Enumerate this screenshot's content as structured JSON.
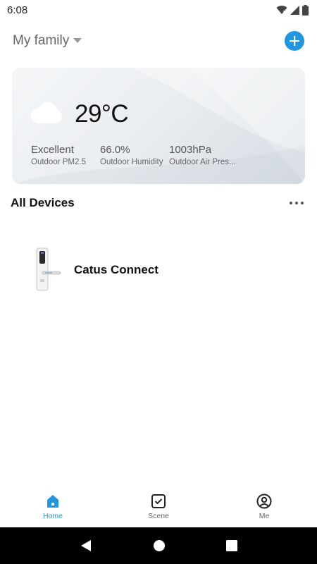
{
  "status_bar": {
    "time": "6:08",
    "icons": [
      "wifi-icon",
      "cell-signal-icon",
      "battery-icon"
    ]
  },
  "header": {
    "family_name": "My family",
    "dropdown_icon": "caret-down-icon",
    "add_icon": "plus-icon"
  },
  "weather": {
    "temperature": "29°C",
    "icon": "cloud-icon",
    "stats": [
      {
        "value": "Excellent",
        "label": "Outdoor PM2.5"
      },
      {
        "value": "66.0%",
        "label": "Outdoor Humidity"
      },
      {
        "value": "1003hPa",
        "label": "Outdoor Air Pres..."
      }
    ]
  },
  "devices": {
    "title": "All Devices",
    "more_icon": "more-horizontal-icon",
    "items": [
      {
        "name": "Catus Connect",
        "icon": "smart-lock-icon"
      }
    ]
  },
  "tabbar": {
    "tabs": [
      {
        "label": "Home",
        "icon": "home-icon",
        "active": true
      },
      {
        "label": "Scene",
        "icon": "scene-check-icon",
        "active": false
      },
      {
        "label": "Me",
        "icon": "profile-icon",
        "active": false
      }
    ]
  },
  "colors": {
    "accent": "#2196e0",
    "text": "#111111",
    "muted": "#666666"
  }
}
